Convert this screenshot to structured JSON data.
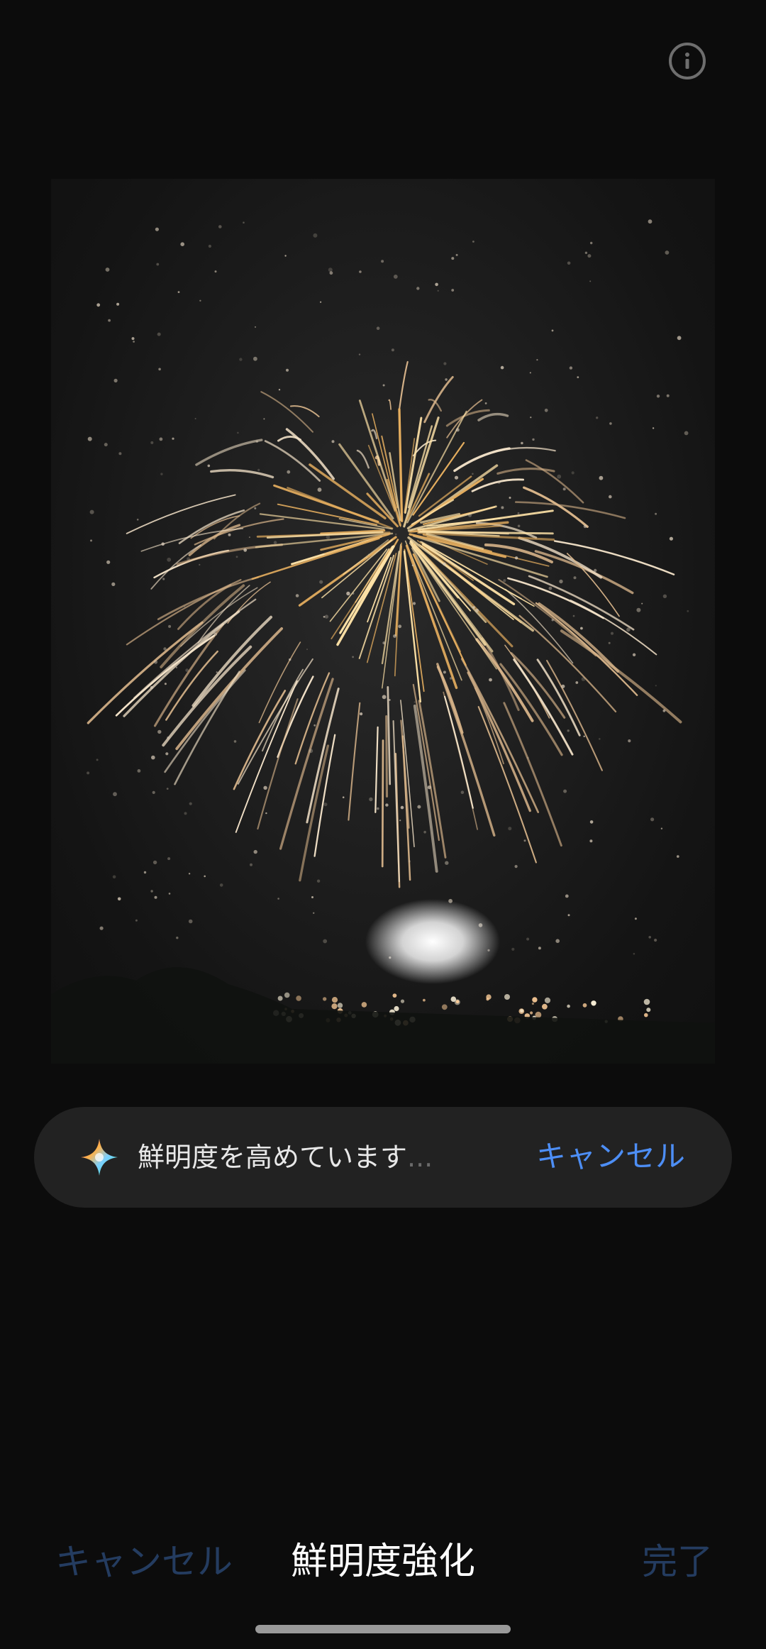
{
  "top_bar": {
    "info_icon": "info-circle-icon"
  },
  "photo": {
    "description_icon": "fireworks-photo"
  },
  "progress": {
    "icon": "ai-sparkle-icon",
    "message": "鮮明度を高めています",
    "dots": "...",
    "cancel_label": "キャンセル"
  },
  "bottom_bar": {
    "cancel_label": "キャンセル",
    "title": "鮮明度強化",
    "done_label": "完了"
  },
  "colors": {
    "background": "#0c0c0c",
    "pill": "#222222",
    "accent": "#4d8ef5",
    "disabled_accent": "#243c60"
  }
}
